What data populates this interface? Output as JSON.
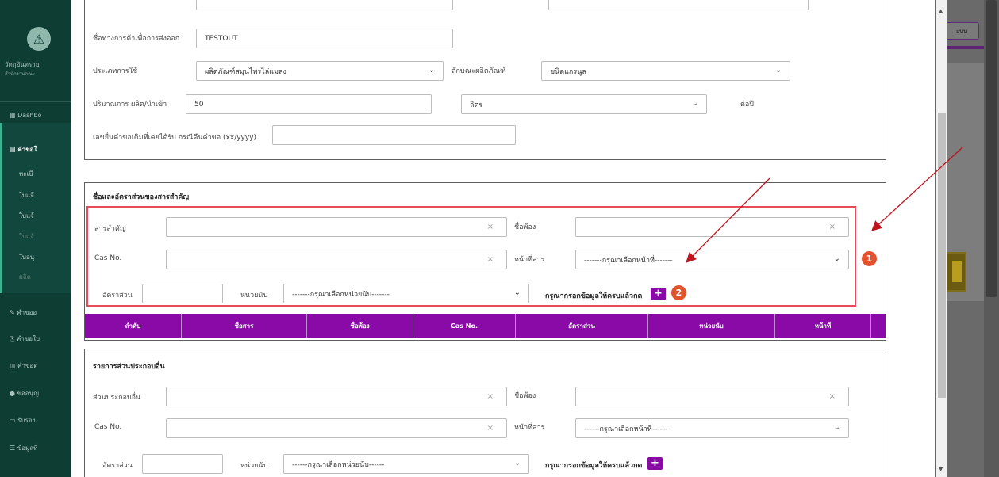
{
  "background": {
    "brand_title": "วัตถุอันตราย",
    "brand_subtitle": "สำนักงานคณะ",
    "nav": {
      "dashboard": "Dashbo",
      "requests": "คำขอใ",
      "sub1": "ทะเบี",
      "sub2": "ใบแจ้",
      "sub3": "ใบแจ้",
      "sub4": "ใบแจ้",
      "sub5": "ใบอนุ",
      "sub6": "ผลิต",
      "item_edit": "คำขออ",
      "item_copy": "คำขอใบ",
      "item_other": "คำขอต่",
      "item_approve": "ขออนุญ",
      "item_cert": "รับรอง",
      "item_data": "ข้อมูลที่"
    },
    "top_right_button": "ะบบ"
  },
  "form_top": {
    "export_name_label": "ชื่อทางการค้าเพื่อการส่งออก",
    "export_name_value": "TESTOUT",
    "usage_type_label": "ประเภทการใช้",
    "usage_type_value": "ผลิตภัณฑ์สมุนไพรไล่แมลง",
    "product_form_label": "ลักษณะผลิตภัณฑ์",
    "product_form_value": "ชนิดแกรนูล",
    "quantity_label": "ปริมาณการ ผลิต/นำเข้า",
    "quantity_value": "50",
    "unit_value": "ลิตร",
    "per_year_label": "ต่อปี",
    "old_request_label": "เลขยื่นคำขอเดิมที่เคยได้รับ กรณีคืนคำขอ (xx/yyyy)",
    "old_request_value": ""
  },
  "substance_section": {
    "title": "ชื่อและอัตราส่วนของสารสำคัญ",
    "substance_label": "สารสำคัญ",
    "common_name_label": "ชื่อพ้อง",
    "cas_label": "Cas No.",
    "function_label": "หน้าที่สาร",
    "function_placeholder": "-------กรุณาเลือกหน้าที่-------",
    "ratio_label": "อัตราส่วน",
    "unit_label": "หน่วยนับ",
    "unit_placeholder": "-------กรุณาเลือกหน่วยนับ-------",
    "add_hint": "กรุณากรอกข้อมูลให้ครบแล้วกด",
    "add_button": "+",
    "badge_1": "1",
    "badge_2": "2",
    "table_headers": [
      "ลำดับ",
      "ชื่อสาร",
      "ชื่อพ้อง",
      "Cas No.",
      "อัตราส่วน",
      "หน่วยนับ",
      "หน้าที่"
    ]
  },
  "other_section": {
    "title": "รายการส่วนประกอบอื่น",
    "component_label": "ส่วนประกอบอื่น",
    "common_name_label": "ชื่อพ้อง",
    "cas_label": "Cas No.",
    "function_label": "หน้าที่สาร",
    "function_placeholder": "------กรุณาเลือกหน้าที่------",
    "ratio_label": "อัตราส่วน",
    "unit_label": "หน่วยนับ",
    "unit_placeholder": "------กรุณาเลือกหน่วยนับ------",
    "add_hint": "กรุณากรอกข้อมูลให้ครบแล้วกด",
    "add_button": "+"
  },
  "clear_symbol": "×",
  "dropdown_symbol": "⌄",
  "colors": {
    "purple": "#8a0aa8",
    "red_box": "#e8495b",
    "badge": "#e2522d",
    "arrow": "#c0141e",
    "sidebar": "#0e3d34"
  }
}
